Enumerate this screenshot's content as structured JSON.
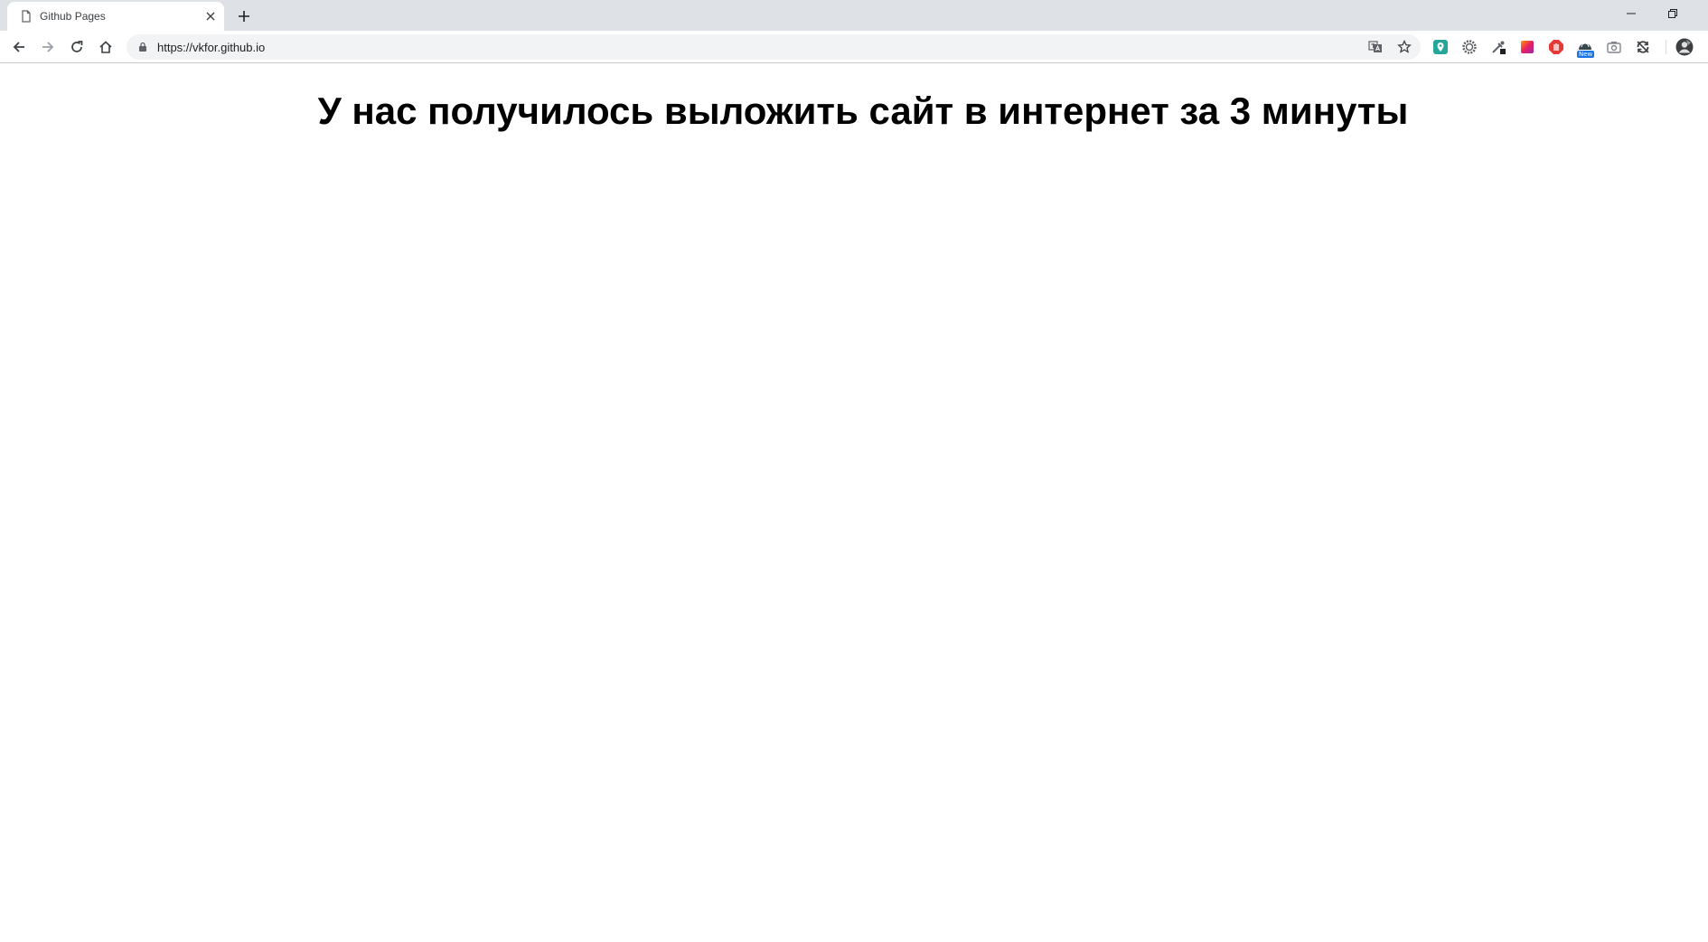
{
  "window": {
    "tabs": [
      {
        "title": "Github Pages",
        "favicon": "page-icon",
        "active": true
      }
    ],
    "controls": [
      "minimize-icon",
      "restore-icon"
    ]
  },
  "toolbar": {
    "url": "https://vkfor.github.io",
    "nav_icons": [
      "back-arrow-icon",
      "forward-arrow-icon",
      "reload-icon",
      "home-icon"
    ],
    "omnibox_icons": [
      "translate-icon",
      "bookmark-star-icon"
    ],
    "extensions": [
      {
        "icon": "map-pin-extension-icon",
        "color": "#26a69a"
      },
      {
        "icon": "gear-extension-icon",
        "color": "#5f6368"
      },
      {
        "icon": "eyedropper-extension-icon",
        "color": "#5f6368"
      },
      {
        "icon": "gradient-extension-icon",
        "color": "#e91e63"
      },
      {
        "icon": "stop-hand-extension-icon",
        "color": "#e53935"
      },
      {
        "icon": "dome-extension-icon",
        "color": "#37474f",
        "badge": "New"
      },
      {
        "icon": "camera-extension-icon",
        "color": "#80868b"
      },
      {
        "icon": "sync-extension-icon",
        "color": "#3c4043"
      }
    ],
    "profile_icon": "avatar-icon"
  },
  "page": {
    "heading": "У нас получилось выложить сайт в интернет за 3 минуты"
  },
  "colors": {
    "tab_strip": "#dee1e6",
    "omnibox": "#f1f3f4",
    "page_background": "#ffffff",
    "heading_text": "#000000"
  }
}
